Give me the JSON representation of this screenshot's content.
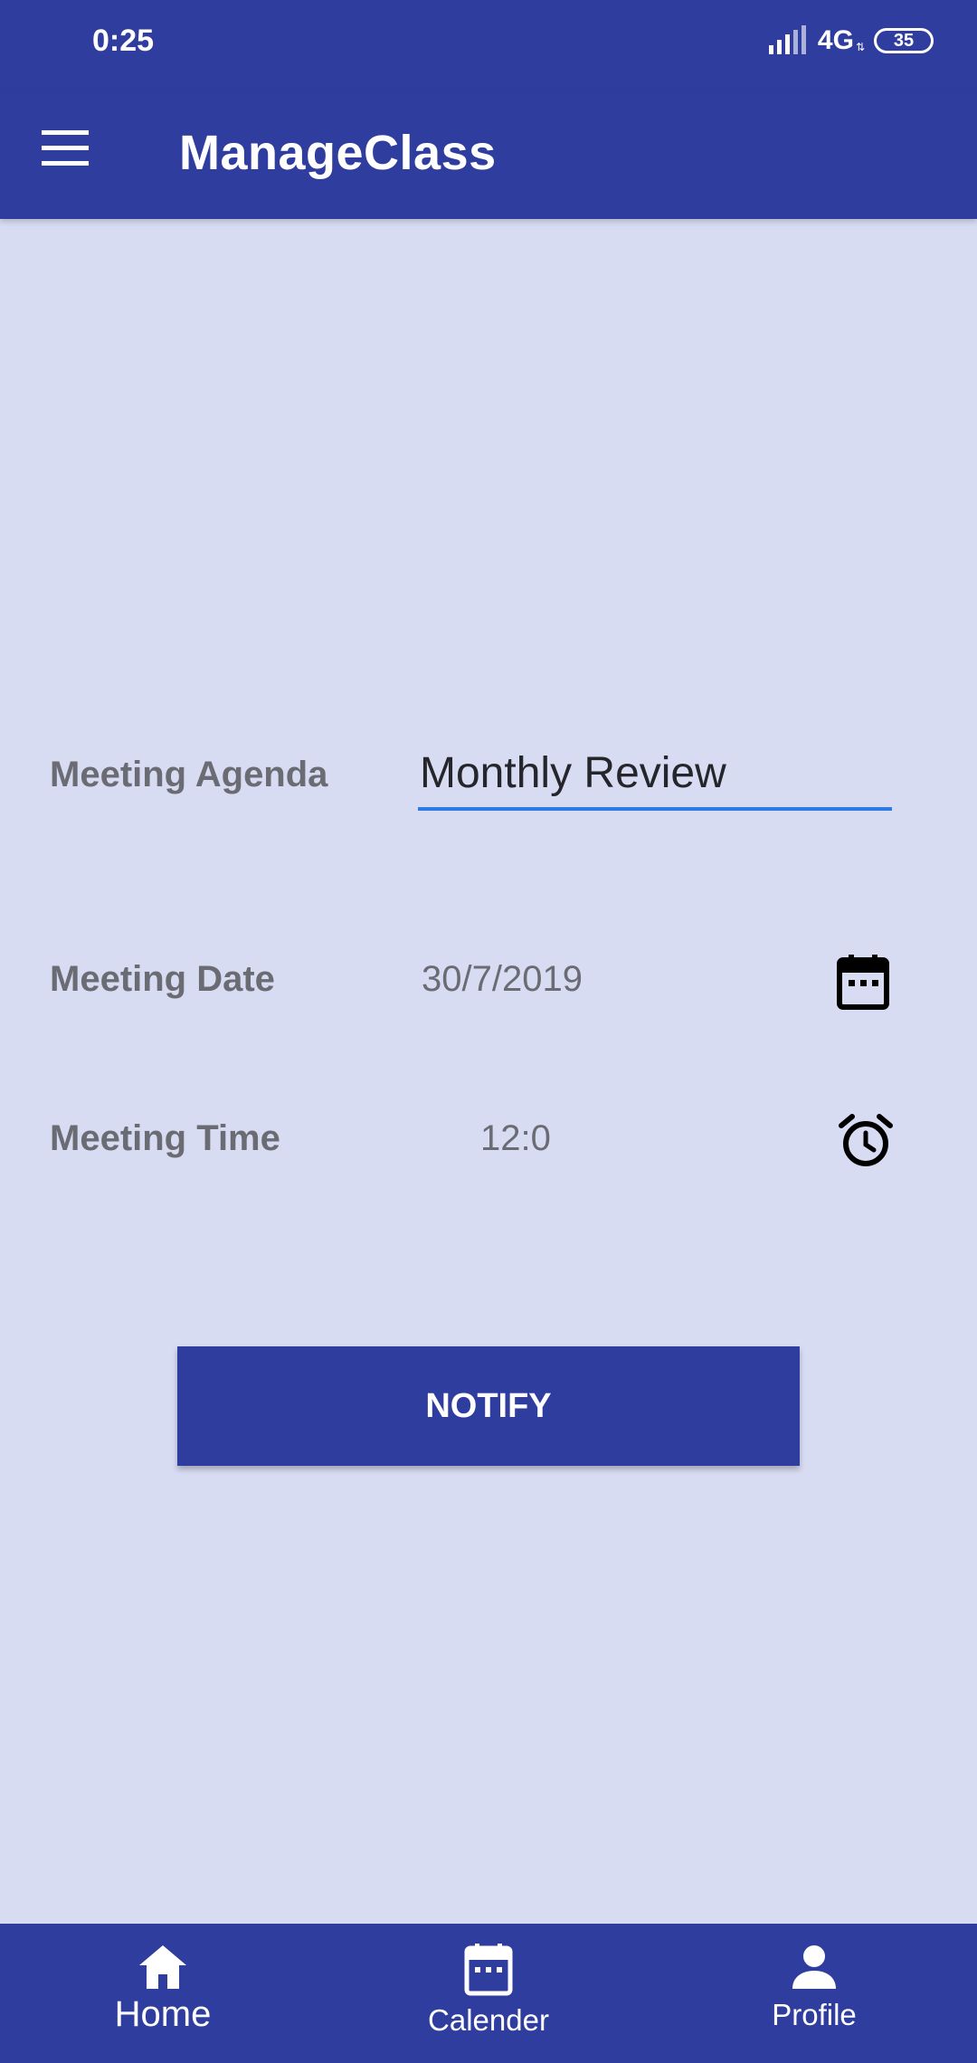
{
  "status_bar": {
    "time": "0:25",
    "network": "4G",
    "battery": "35"
  },
  "app_bar": {
    "title": "ManageClass"
  },
  "form": {
    "agenda_label": "Meeting Agenda",
    "agenda_value": "Monthly Review",
    "date_label": "Meeting Date",
    "date_value": "30/7/2019",
    "time_label": "Meeting Time",
    "time_value": "12:0"
  },
  "notify_button": {
    "label": "NOTIFY"
  },
  "bottom_nav": {
    "items": [
      {
        "label": "Home",
        "icon": "home-icon"
      },
      {
        "label": "Calender",
        "icon": "calendar-icon"
      },
      {
        "label": "Profile",
        "icon": "person-icon"
      }
    ]
  },
  "colors": {
    "primary": "#2f3e9e",
    "background": "#d8dcf3",
    "accent": "#2f7be5"
  }
}
